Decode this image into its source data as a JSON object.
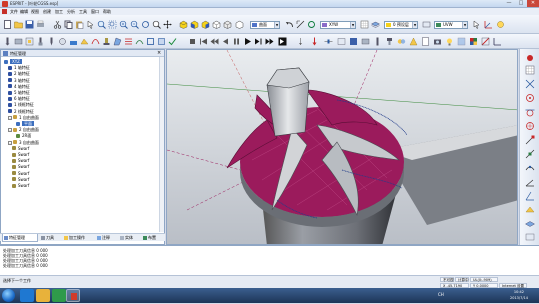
{
  "window": {
    "title": "ESPRIT - [叶轮CGSS.esp]",
    "min_label": "—",
    "max_label": "□",
    "close_label": "✕"
  },
  "menu": {
    "items": [
      "文件",
      "编辑",
      "视图",
      "创建",
      "加工",
      "分析",
      "工具",
      "窗口",
      "帮助"
    ]
  },
  "toolbar": {
    "view_combo": "曲面",
    "xyz_combo": "XYW",
    "layer_combo": "0 预设层",
    "work_combo": "UVW"
  },
  "panel": {
    "title": "特征管理",
    "close_label": "×",
    "tree": [
      {
        "label": "XYZ",
        "selected": true,
        "indent": 0,
        "icon": "gear-icon",
        "color": "#3d6fbe"
      },
      {
        "label": "1 轴特征",
        "indent": 1,
        "icon": "feature-icon",
        "color": "#2e4fa0"
      },
      {
        "label": "2 轴特征",
        "indent": 1,
        "icon": "feature-icon",
        "color": "#2e4fa0"
      },
      {
        "label": "3 轴特征",
        "indent": 1,
        "icon": "feature-icon",
        "color": "#2e4fa0"
      },
      {
        "label": "4 轴特征",
        "indent": 1,
        "icon": "feature-icon",
        "color": "#2e4fa0"
      },
      {
        "label": "5 轴特征",
        "indent": 1,
        "icon": "feature-icon",
        "color": "#2e4fa0"
      },
      {
        "label": "6 轴特征",
        "indent": 1,
        "icon": "feature-icon",
        "color": "#2e4fa0"
      },
      {
        "label": "1 线框特征",
        "indent": 1,
        "icon": "feature-icon",
        "color": "#2e4fa0"
      },
      {
        "label": "2 线框特征",
        "indent": 1,
        "icon": "feature-icon",
        "color": "#2e4fa0"
      },
      {
        "label": "1 自由曲面",
        "indent": 1,
        "expand": true,
        "icon": "surface-icon",
        "color": "#c8a040"
      },
      {
        "label": "平面",
        "indent": 3,
        "selected": true,
        "icon": "surface-icon",
        "color": "#3d6fbe"
      },
      {
        "label": "2 自由曲面",
        "indent": 1,
        "expand": true,
        "icon": "surface-icon",
        "color": "#c8a040"
      },
      {
        "label": "2R面",
        "indent": 3,
        "icon": "surface-icon",
        "color": "#5a8a40"
      },
      {
        "label": "3 自由曲面",
        "indent": 1,
        "expand": true,
        "icon": "surface-icon",
        "color": "#c8a040"
      },
      {
        "label": "Swarf",
        "indent": 2,
        "icon": "toolpath-icon",
        "color": "#9a8a40"
      },
      {
        "label": "Swarf",
        "indent": 2,
        "icon": "toolpath-icon",
        "color": "#9a8a40"
      },
      {
        "label": "Swarf",
        "indent": 2,
        "icon": "toolpath-icon",
        "color": "#9a8a40"
      },
      {
        "label": "Swarf",
        "indent": 2,
        "icon": "toolpath-icon",
        "color": "#9a8a40"
      },
      {
        "label": "Swarf",
        "indent": 2,
        "icon": "toolpath-icon",
        "color": "#9a8a40"
      },
      {
        "label": "Swarf",
        "indent": 2,
        "icon": "toolpath-icon",
        "color": "#9a8a40"
      },
      {
        "label": "Swarf",
        "indent": 2,
        "icon": "toolpath-icon",
        "color": "#9a8a40"
      }
    ],
    "tabs": [
      "特征管理",
      "刀具",
      "加工操作",
      "注释",
      "实体",
      "布置"
    ]
  },
  "output": {
    "lines": [
      "处理加工刀具信息 0 000",
      "处理加工刀具信息 0 000",
      "处理加工刀具信息 0 000",
      "处理加工刀具信息 0 000"
    ]
  },
  "status": {
    "message": "选择下一个工作",
    "fields": [
      "不可视",
      "计算中",
      "UL(0:-909)",
      "X -45.7190",
      "Y 0.0000",
      "Internet 设置"
    ]
  },
  "taskbar": {
    "lang": "CH",
    "time": "10:42",
    "date": "2013/7/14"
  },
  "colors": {
    "accent": "#3d6fbe",
    "surface_magenta": "#9b1b5c",
    "viewport_bg": "#c8ccd2"
  }
}
